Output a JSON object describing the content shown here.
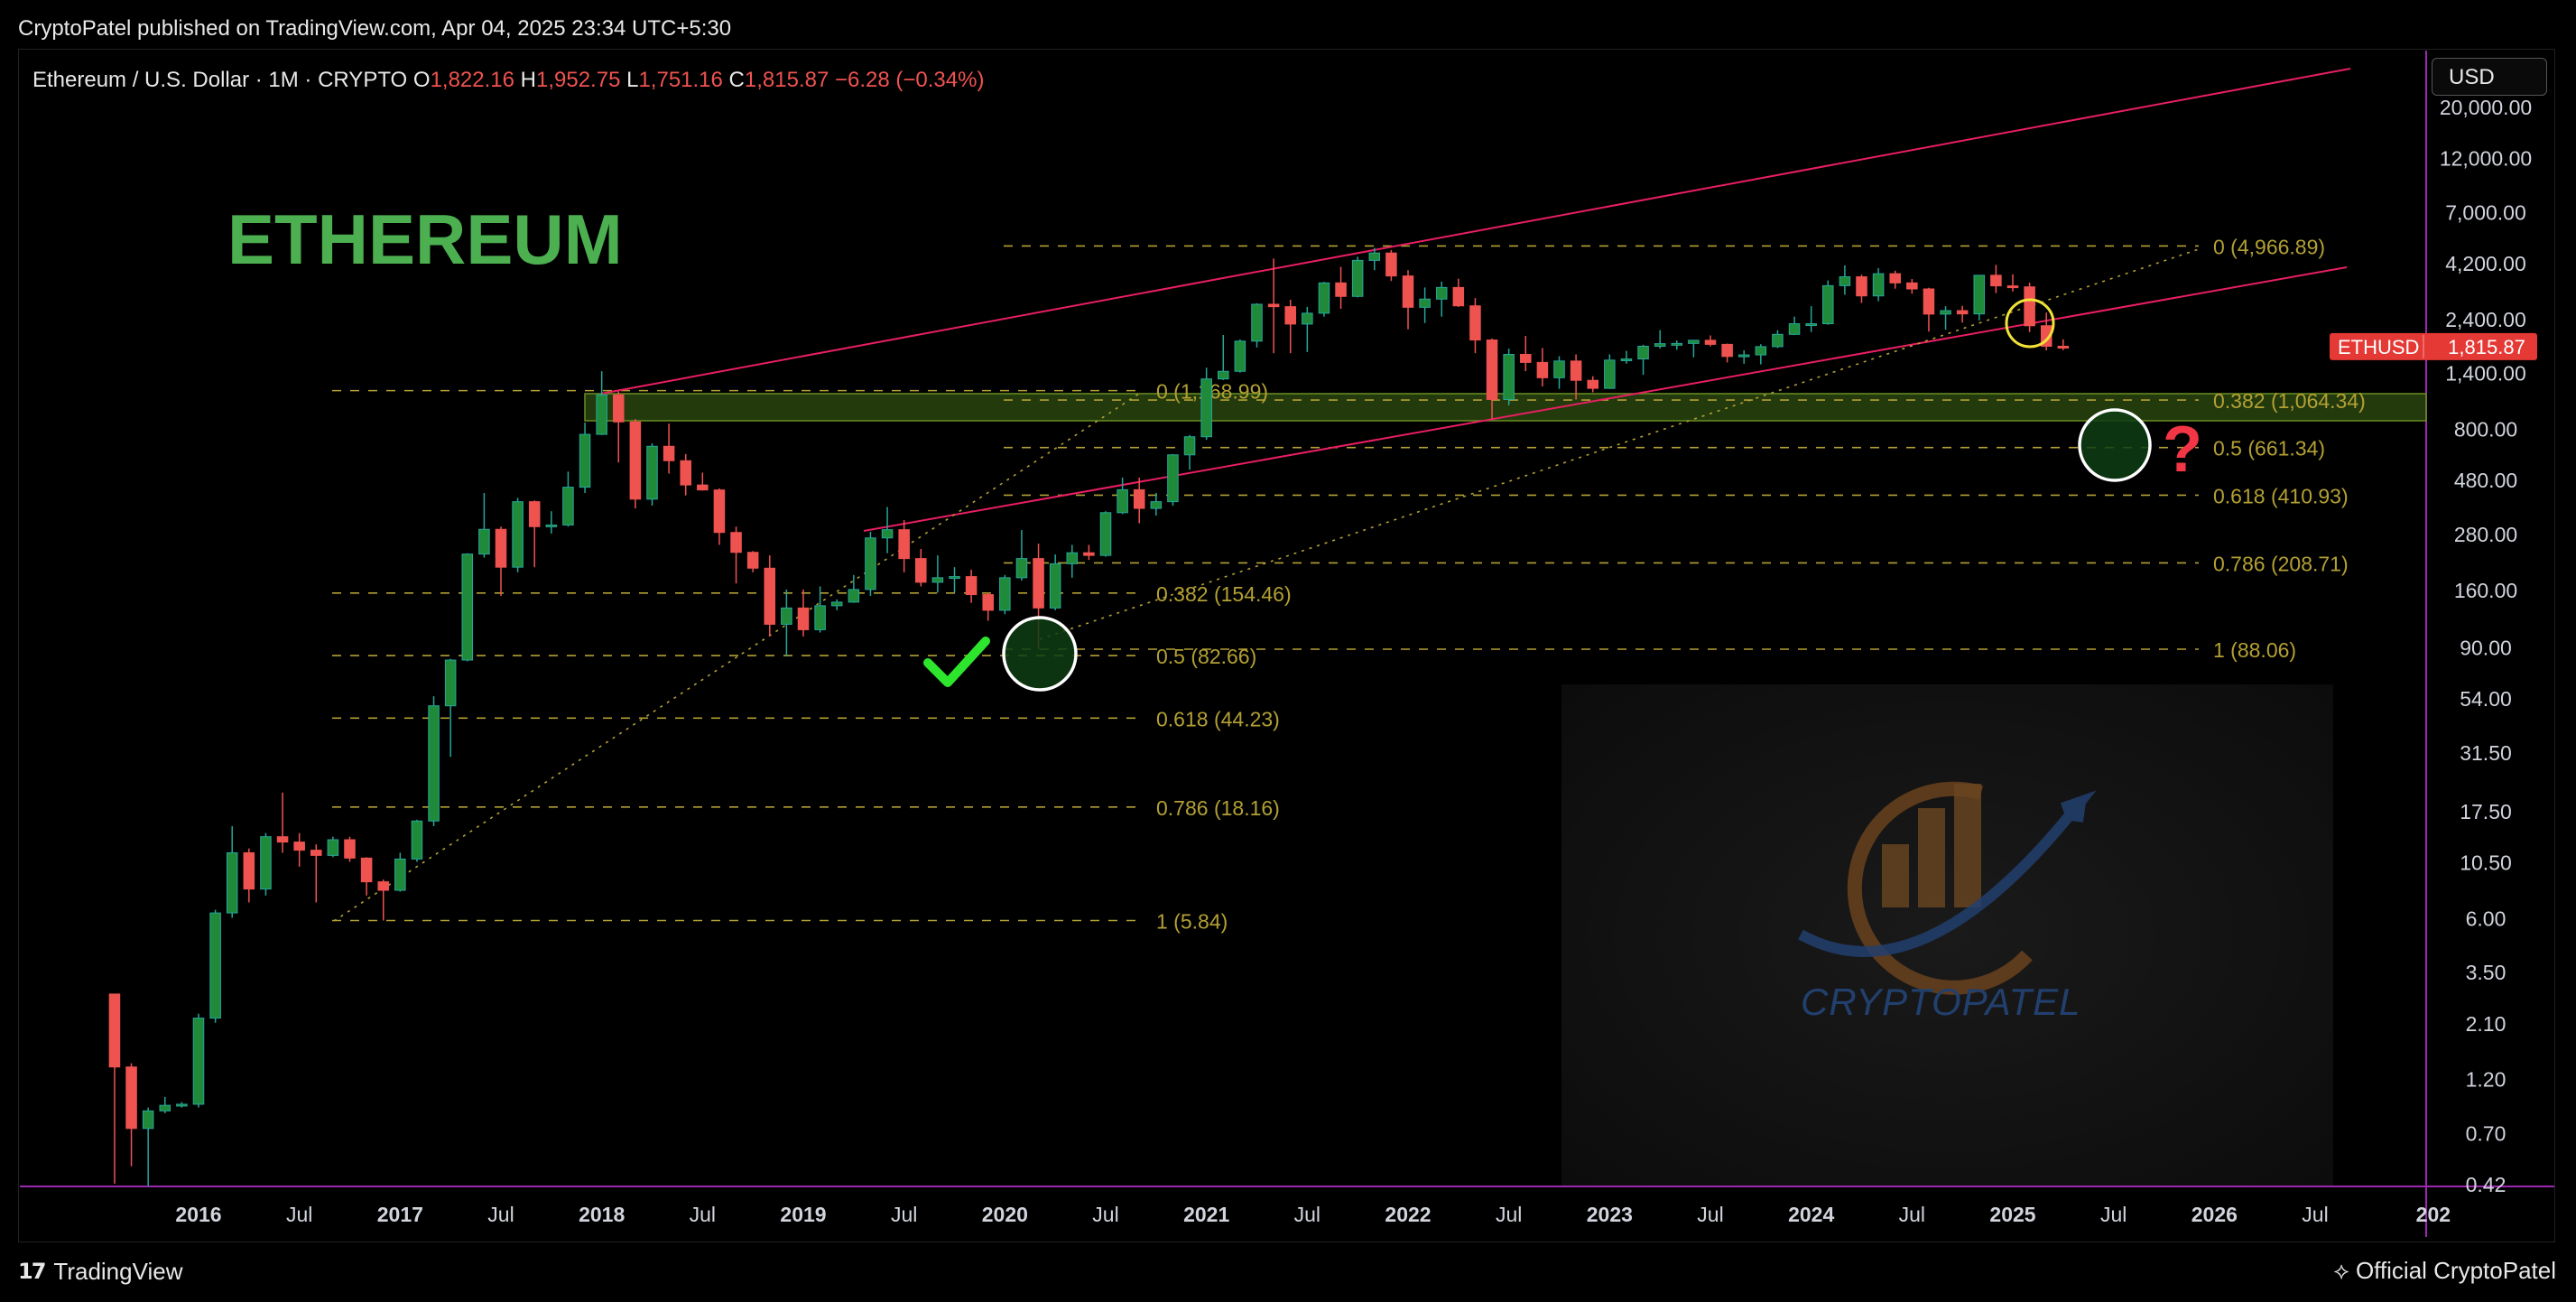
{
  "header": {
    "published": "CryptoPatel published on TradingView.com, Apr 04, 2025 23:34 UTC+5:30"
  },
  "currency_button": "USD",
  "footer": {
    "brand": "TradingView",
    "author": "Official CryptoPatel"
  },
  "chart_data": {
    "type": "candlestick",
    "symbol_line": {
      "symbol": "Ethereum / U.S. Dollar · 1M · CRYPTO",
      "open_label": "O",
      "open": "1,822.16",
      "high_label": "H",
      "high": "1,952.75",
      "low_label": "L",
      "low": "1,751.16",
      "close_label": "C",
      "close": "1,815.87",
      "change": "−6.28 (−0.34%)"
    },
    "watermark_title": "ETHEREUM",
    "logo_text": "CRYPTOPATEL",
    "scale": "log",
    "y_ticks": [
      "20,000.00",
      "12,000.00",
      "7,000.00",
      "4,200.00",
      "2,400.00",
      "1,400.00",
      "800.00",
      "480.00",
      "280.00",
      "160.00",
      "90.00",
      "54.00",
      "31.50",
      "17.50",
      "10.50",
      "6.00",
      "3.50",
      "2.10",
      "1.20",
      "0.70",
      "0.42"
    ],
    "x_ticks": [
      "2016",
      "Jul",
      "2017",
      "Jul",
      "2018",
      "Jul",
      "2019",
      "Jul",
      "2020",
      "Jul",
      "2021",
      "Jul",
      "2022",
      "Jul",
      "2023",
      "Jul",
      "2024",
      "Jul",
      "2025",
      "Jul",
      "2026",
      "Jul",
      "202"
    ],
    "x_range": [
      "2015-08",
      "2026-12"
    ],
    "price_label": {
      "name": "ETHUSD",
      "value": "1,815.87"
    },
    "candles": [
      {
        "t": "2015-08",
        "o": 2.8,
        "h": 2.8,
        "l": 0.42,
        "c": 1.35
      },
      {
        "t": "2015-09",
        "o": 1.35,
        "h": 1.4,
        "l": 0.5,
        "c": 0.73
      },
      {
        "t": "2015-10",
        "o": 0.73,
        "h": 0.9,
        "l": 0.41,
        "c": 0.87
      },
      {
        "t": "2015-11",
        "o": 0.87,
        "h": 1.0,
        "l": 0.85,
        "c": 0.92
      },
      {
        "t": "2015-12",
        "o": 0.92,
        "h": 0.95,
        "l": 0.9,
        "c": 0.93
      },
      {
        "t": "2016-01",
        "o": 0.93,
        "h": 2.3,
        "l": 0.9,
        "c": 2.2
      },
      {
        "t": "2016-02",
        "o": 2.2,
        "h": 6.5,
        "l": 2.1,
        "c": 6.3
      },
      {
        "t": "2016-03",
        "o": 6.3,
        "h": 15.0,
        "l": 6.0,
        "c": 11.5
      },
      {
        "t": "2016-04",
        "o": 11.5,
        "h": 12.0,
        "l": 7.0,
        "c": 8.0
      },
      {
        "t": "2016-05",
        "o": 8.0,
        "h": 14.0,
        "l": 7.5,
        "c": 13.5
      },
      {
        "t": "2016-06",
        "o": 13.5,
        "h": 21.0,
        "l": 11.5,
        "c": 12.8
      },
      {
        "t": "2016-07",
        "o": 12.8,
        "h": 14.0,
        "l": 10.0,
        "c": 11.8
      },
      {
        "t": "2016-08",
        "o": 11.8,
        "h": 12.5,
        "l": 7.0,
        "c": 11.2
      },
      {
        "t": "2016-09",
        "o": 11.2,
        "h": 13.5,
        "l": 11.0,
        "c": 13.1
      },
      {
        "t": "2016-10",
        "o": 13.1,
        "h": 13.5,
        "l": 10.5,
        "c": 10.9
      },
      {
        "t": "2016-11",
        "o": 10.9,
        "h": 11.0,
        "l": 7.5,
        "c": 8.6
      },
      {
        "t": "2016-12",
        "o": 8.6,
        "h": 8.8,
        "l": 5.84,
        "c": 7.9
      },
      {
        "t": "2017-01",
        "o": 7.9,
        "h": 11.5,
        "l": 7.8,
        "c": 10.8
      },
      {
        "t": "2017-02",
        "o": 10.8,
        "h": 16.0,
        "l": 10.5,
        "c": 15.8
      },
      {
        "t": "2017-03",
        "o": 15.8,
        "h": 55.0,
        "l": 15.0,
        "c": 50.0
      },
      {
        "t": "2017-04",
        "o": 50.0,
        "h": 80.0,
        "l": 30.0,
        "c": 79.0
      },
      {
        "t": "2017-05",
        "o": 79.0,
        "h": 230.0,
        "l": 78.0,
        "c": 228.0
      },
      {
        "t": "2017-06",
        "o": 228.0,
        "h": 420.0,
        "l": 220.0,
        "c": 292.0
      },
      {
        "t": "2017-07",
        "o": 292.0,
        "h": 300.0,
        "l": 150.0,
        "c": 200.0
      },
      {
        "t": "2017-08",
        "o": 200.0,
        "h": 400.0,
        "l": 190.0,
        "c": 385.0
      },
      {
        "t": "2017-09",
        "o": 385.0,
        "h": 390.0,
        "l": 200.0,
        "c": 300.0
      },
      {
        "t": "2017-10",
        "o": 300.0,
        "h": 350.0,
        "l": 280.0,
        "c": 305.0
      },
      {
        "t": "2017-11",
        "o": 305.0,
        "h": 520.0,
        "l": 300.0,
        "c": 445.0
      },
      {
        "t": "2017-12",
        "o": 445.0,
        "h": 850.0,
        "l": 420.0,
        "c": 755.0
      },
      {
        "t": "2018-01",
        "o": 755.0,
        "h": 1420.0,
        "l": 750.0,
        "c": 1120.0
      },
      {
        "t": "2018-02",
        "o": 1120.0,
        "h": 1160.0,
        "l": 570.0,
        "c": 855.0
      },
      {
        "t": "2018-03",
        "o": 855.0,
        "h": 880.0,
        "l": 360.0,
        "c": 395.0
      },
      {
        "t": "2018-04",
        "o": 395.0,
        "h": 690.0,
        "l": 370.0,
        "c": 670.0
      },
      {
        "t": "2018-05",
        "o": 670.0,
        "h": 840.0,
        "l": 510.0,
        "c": 580.0
      },
      {
        "t": "2018-06",
        "o": 580.0,
        "h": 620.0,
        "l": 410.0,
        "c": 455.0
      },
      {
        "t": "2018-07",
        "o": 455.0,
        "h": 515.0,
        "l": 430.0,
        "c": 433.0
      },
      {
        "t": "2018-08",
        "o": 433.0,
        "h": 440.0,
        "l": 250.0,
        "c": 283.0
      },
      {
        "t": "2018-09",
        "o": 283.0,
        "h": 300.0,
        "l": 170.0,
        "c": 232.0
      },
      {
        "t": "2018-10",
        "o": 232.0,
        "h": 235.0,
        "l": 190.0,
        "c": 198.0
      },
      {
        "t": "2018-11",
        "o": 198.0,
        "h": 225.0,
        "l": 100.0,
        "c": 113.0
      },
      {
        "t": "2018-12",
        "o": 113.0,
        "h": 160.0,
        "l": 82.0,
        "c": 133.0
      },
      {
        "t": "2019-01",
        "o": 133.0,
        "h": 160.0,
        "l": 100.0,
        "c": 107.0
      },
      {
        "t": "2019-02",
        "o": 107.0,
        "h": 165.0,
        "l": 104.0,
        "c": 136.0
      },
      {
        "t": "2019-03",
        "o": 136.0,
        "h": 145.0,
        "l": 130.0,
        "c": 141.0
      },
      {
        "t": "2019-04",
        "o": 141.0,
        "h": 185.0,
        "l": 140.0,
        "c": 160.0
      },
      {
        "t": "2019-05",
        "o": 160.0,
        "h": 285.0,
        "l": 150.0,
        "c": 268.0
      },
      {
        "t": "2019-06",
        "o": 268.0,
        "h": 365.0,
        "l": 230.0,
        "c": 291.0
      },
      {
        "t": "2019-07",
        "o": 291.0,
        "h": 320.0,
        "l": 190.0,
        "c": 218.0
      },
      {
        "t": "2019-08",
        "o": 218.0,
        "h": 240.0,
        "l": 165.0,
        "c": 172.0
      },
      {
        "t": "2019-09",
        "o": 172.0,
        "h": 225.0,
        "l": 155.0,
        "c": 180.0
      },
      {
        "t": "2019-10",
        "o": 180.0,
        "h": 200.0,
        "l": 155.0,
        "c": 182.0
      },
      {
        "t": "2019-11",
        "o": 182.0,
        "h": 195.0,
        "l": 140.0,
        "c": 152.0
      },
      {
        "t": "2019-12",
        "o": 152.0,
        "h": 155.0,
        "l": 117.0,
        "c": 130.0
      },
      {
        "t": "2020-01",
        "o": 130.0,
        "h": 185.0,
        "l": 125.0,
        "c": 180.0
      },
      {
        "t": "2020-02",
        "o": 180.0,
        "h": 290.0,
        "l": 175.0,
        "c": 218.0
      },
      {
        "t": "2020-03",
        "o": 218.0,
        "h": 253.0,
        "l": 88.0,
        "c": 133.0
      },
      {
        "t": "2020-04",
        "o": 133.0,
        "h": 227.0,
        "l": 130.0,
        "c": 207.0
      },
      {
        "t": "2020-05",
        "o": 207.0,
        "h": 250.0,
        "l": 180.0,
        "c": 231.0
      },
      {
        "t": "2020-06",
        "o": 231.0,
        "h": 250.0,
        "l": 215.0,
        "c": 225.0
      },
      {
        "t": "2020-07",
        "o": 225.0,
        "h": 350.0,
        "l": 222.0,
        "c": 345.0
      },
      {
        "t": "2020-08",
        "o": 345.0,
        "h": 490.0,
        "l": 340.0,
        "c": 434.0
      },
      {
        "t": "2020-09",
        "o": 434.0,
        "h": 490.0,
        "l": 310.0,
        "c": 360.0
      },
      {
        "t": "2020-10",
        "o": 360.0,
        "h": 420.0,
        "l": 335.0,
        "c": 385.0
      },
      {
        "t": "2020-11",
        "o": 385.0,
        "h": 620.0,
        "l": 370.0,
        "c": 615.0
      },
      {
        "t": "2020-12",
        "o": 615.0,
        "h": 750.0,
        "l": 530.0,
        "c": 737.0
      },
      {
        "t": "2021-01",
        "o": 737.0,
        "h": 1470.0,
        "l": 715.0,
        "c": 1314.0
      },
      {
        "t": "2021-02",
        "o": 1314.0,
        "h": 2040.0,
        "l": 1300.0,
        "c": 1418.0
      },
      {
        "t": "2021-03",
        "o": 1418.0,
        "h": 1950.0,
        "l": 1400.0,
        "c": 1918.0
      },
      {
        "t": "2021-04",
        "o": 1918.0,
        "h": 2800.0,
        "l": 1800.0,
        "c": 2773.0
      },
      {
        "t": "2021-05",
        "o": 2773.0,
        "h": 4380.0,
        "l": 1700.0,
        "c": 2707.0
      },
      {
        "t": "2021-06",
        "o": 2707.0,
        "h": 2900.0,
        "l": 1700.0,
        "c": 2275.0
      },
      {
        "t": "2021-07",
        "o": 2275.0,
        "h": 2700.0,
        "l": 1720.0,
        "c": 2536.0
      },
      {
        "t": "2021-08",
        "o": 2536.0,
        "h": 3470.0,
        "l": 2450.0,
        "c": 3433.0
      },
      {
        "t": "2021-09",
        "o": 3433.0,
        "h": 4030.0,
        "l": 2650.0,
        "c": 3000.0
      },
      {
        "t": "2021-10",
        "o": 3000.0,
        "h": 4460.0,
        "l": 2970.0,
        "c": 4300.0
      },
      {
        "t": "2021-11",
        "o": 4300.0,
        "h": 4870.0,
        "l": 3900.0,
        "c": 4630.0
      },
      {
        "t": "2021-12",
        "o": 4630.0,
        "h": 4770.0,
        "l": 3500.0,
        "c": 3680.0
      },
      {
        "t": "2022-01",
        "o": 3680.0,
        "h": 3900.0,
        "l": 2160.0,
        "c": 2690.0
      },
      {
        "t": "2022-02",
        "o": 2690.0,
        "h": 3280.0,
        "l": 2300.0,
        "c": 2920.0
      },
      {
        "t": "2022-03",
        "o": 2920.0,
        "h": 3480.0,
        "l": 2450.0,
        "c": 3280.0
      },
      {
        "t": "2022-04",
        "o": 3280.0,
        "h": 3580.0,
        "l": 2700.0,
        "c": 2730.0
      },
      {
        "t": "2022-05",
        "o": 2730.0,
        "h": 2950.0,
        "l": 1700.0,
        "c": 1940.0
      },
      {
        "t": "2022-06",
        "o": 1940.0,
        "h": 1970.0,
        "l": 880.0,
        "c": 1070.0
      },
      {
        "t": "2022-07",
        "o": 1070.0,
        "h": 1780.0,
        "l": 1010.0,
        "c": 1680.0
      },
      {
        "t": "2022-08",
        "o": 1680.0,
        "h": 2020.0,
        "l": 1420.0,
        "c": 1550.0
      },
      {
        "t": "2022-09",
        "o": 1550.0,
        "h": 1790.0,
        "l": 1220.0,
        "c": 1330.0
      },
      {
        "t": "2022-10",
        "o": 1330.0,
        "h": 1650.0,
        "l": 1190.0,
        "c": 1572.0
      },
      {
        "t": "2022-11",
        "o": 1572.0,
        "h": 1680.0,
        "l": 1070.0,
        "c": 1296.0
      },
      {
        "t": "2022-12",
        "o": 1296.0,
        "h": 1350.0,
        "l": 1150.0,
        "c": 1196.0
      },
      {
        "t": "2023-01",
        "o": 1196.0,
        "h": 1680.0,
        "l": 1190.0,
        "c": 1586.0
      },
      {
        "t": "2023-02",
        "o": 1586.0,
        "h": 1740.0,
        "l": 1530.0,
        "c": 1605.0
      },
      {
        "t": "2023-03",
        "o": 1605.0,
        "h": 1850.0,
        "l": 1370.0,
        "c": 1822.0
      },
      {
        "t": "2023-04",
        "o": 1822.0,
        "h": 2140.0,
        "l": 1780.0,
        "c": 1870.0
      },
      {
        "t": "2023-05",
        "o": 1870.0,
        "h": 1930.0,
        "l": 1760.0,
        "c": 1874.0
      },
      {
        "t": "2023-06",
        "o": 1874.0,
        "h": 1930.0,
        "l": 1630.0,
        "c": 1934.0
      },
      {
        "t": "2023-07",
        "o": 1934.0,
        "h": 2030.0,
        "l": 1820.0,
        "c": 1857.0
      },
      {
        "t": "2023-08",
        "o": 1857.0,
        "h": 1870.0,
        "l": 1550.0,
        "c": 1645.0
      },
      {
        "t": "2023-09",
        "o": 1645.0,
        "h": 1750.0,
        "l": 1530.0,
        "c": 1671.0
      },
      {
        "t": "2023-10",
        "o": 1671.0,
        "h": 1860.0,
        "l": 1520.0,
        "c": 1815.0
      },
      {
        "t": "2023-11",
        "o": 1815.0,
        "h": 2140.0,
        "l": 1790.0,
        "c": 2052.0
      },
      {
        "t": "2023-12",
        "o": 2052.0,
        "h": 2450.0,
        "l": 2040.0,
        "c": 2282.0
      },
      {
        "t": "2024-01",
        "o": 2282.0,
        "h": 2720.0,
        "l": 2100.0,
        "c": 2283.0
      },
      {
        "t": "2024-02",
        "o": 2283.0,
        "h": 3520.0,
        "l": 2260.0,
        "c": 3340.0
      },
      {
        "t": "2024-03",
        "o": 3340.0,
        "h": 4090.0,
        "l": 3050.0,
        "c": 3650.0
      },
      {
        "t": "2024-04",
        "o": 3650.0,
        "h": 3730.0,
        "l": 2810.0,
        "c": 3015.0
      },
      {
        "t": "2024-05",
        "o": 3015.0,
        "h": 3980.0,
        "l": 2860.0,
        "c": 3765.0
      },
      {
        "t": "2024-06",
        "o": 3765.0,
        "h": 3880.0,
        "l": 3240.0,
        "c": 3433.0
      },
      {
        "t": "2024-07",
        "o": 3433.0,
        "h": 3570.0,
        "l": 3080.0,
        "c": 3232.0
      },
      {
        "t": "2024-08",
        "o": 3232.0,
        "h": 3270.0,
        "l": 2110.0,
        "c": 2513.0
      },
      {
        "t": "2024-09",
        "o": 2513.0,
        "h": 2720.0,
        "l": 2150.0,
        "c": 2602.0
      },
      {
        "t": "2024-10",
        "o": 2602.0,
        "h": 2730.0,
        "l": 2310.0,
        "c": 2518.0
      },
      {
        "t": "2024-11",
        "o": 2518.0,
        "h": 3690.0,
        "l": 2360.0,
        "c": 3705.0
      },
      {
        "t": "2024-12",
        "o": 3705.0,
        "h": 4110.0,
        "l": 3100.0,
        "c": 3333.0
      },
      {
        "t": "2025-01",
        "o": 3333.0,
        "h": 3740.0,
        "l": 3150.0,
        "c": 3300.0
      },
      {
        "t": "2025-02",
        "o": 3300.0,
        "h": 3440.0,
        "l": 2100.0,
        "c": 2237.0
      },
      {
        "t": "2025-03",
        "o": 2237.0,
        "h": 2550.0,
        "l": 1750.0,
        "c": 1822.0
      },
      {
        "t": "2025-04",
        "o": 1822.16,
        "h": 1952.75,
        "l": 1751.16,
        "c": 1815.87
      }
    ],
    "fib_upper": {
      "levels": [
        {
          "label": "0 (1,168.99)",
          "price": 1168.99,
          "show": false
        },
        {
          "label": "0 (4,966.89)",
          "price": 4966.89
        },
        {
          "label": "0.382 (1,064.34)",
          "price": 1064.34
        },
        {
          "label": "0.5 (661.34)",
          "price": 661.34
        },
        {
          "label": "0.618 (410.93)",
          "price": 410.93
        },
        {
          "label": "0.786 (208.71)",
          "price": 208.71
        },
        {
          "label": "1 (88.06)",
          "price": 88.06
        }
      ]
    },
    "fib_lower": {
      "levels": [
        {
          "label": "0 (1,168.99)",
          "price": 1168.99
        },
        {
          "label": "0.382 (154.46)",
          "price": 154.46
        },
        {
          "label": "0.5 (82.66)",
          "price": 82.66
        },
        {
          "label": "0.618 (44.23)",
          "price": 44.23
        },
        {
          "label": "0.786 (18.16)",
          "price": 18.16
        },
        {
          "label": "1 (5.84)",
          "price": 5.84
        }
      ]
    },
    "colors": {
      "up": "#26a69a",
      "up_body": "#1f8a3a",
      "down": "#ef5350",
      "channel": "#e91e63",
      "fib": "#b3a034",
      "zone_fill": "#2e4d10",
      "title": "#4caf50",
      "price_tag": "#e53935",
      "axis_text": "#d1d4dc",
      "separator": "#9c27b0"
    }
  }
}
